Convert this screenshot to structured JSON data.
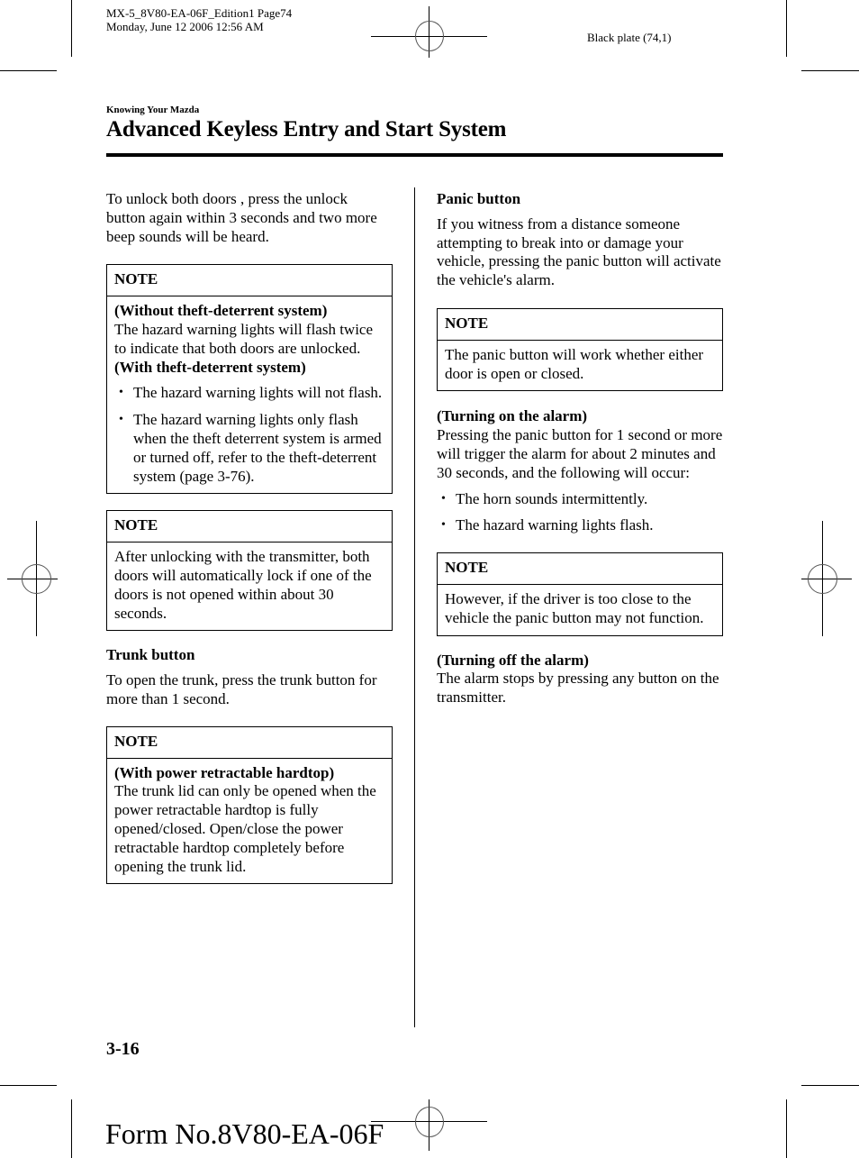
{
  "slug": {
    "line1": "MX-5_8V80-EA-06F_Edition1 Page74",
    "line2": "Monday, June 12 2006 12:56 AM",
    "plate": "Black plate (74,1)"
  },
  "header": {
    "section": "Knowing Your Mazda",
    "title": "Advanced Keyless Entry and Start System"
  },
  "left": {
    "intro": "To unlock both doors , press the unlock button again within 3 seconds and two more beep sounds will be heard.",
    "note1": {
      "label": "NOTE",
      "sub1": "(Without theft-deterrent system)",
      "text1": "The hazard warning lights will flash twice to indicate that both doors are unlocked.",
      "sub2": "(With theft-deterrent system)",
      "bullets": [
        "The hazard warning lights will not flash.",
        "The hazard warning lights only flash when the theft deterrent system is armed or turned off, refer to the theft-deterrent system (page 3-76)."
      ]
    },
    "note2": {
      "label": "NOTE",
      "text": "After unlocking with the transmitter, both doors will automatically lock if one of the doors is not opened within about 30 seconds."
    },
    "trunk_heading": "Trunk button",
    "trunk_text": "To open the trunk, press the trunk button for more than 1 second.",
    "note3": {
      "label": "NOTE",
      "sub": "(With power retractable hardtop)",
      "text": "The trunk lid can only be opened when the power retractable hardtop is fully opened/closed. Open/close the power retractable hardtop completely before opening the trunk lid."
    }
  },
  "right": {
    "panic_heading": "Panic button",
    "panic_text": "If you witness from a distance someone attempting to break into or damage your vehicle, pressing the panic button will activate the vehicle's alarm.",
    "note4": {
      "label": "NOTE",
      "text": "The panic button will work whether either door is open or closed."
    },
    "on_heading": "(Turning on the alarm)",
    "on_text": "Pressing the panic button for 1 second or more will trigger the alarm for about 2 minutes and 30 seconds, and the following will occur:",
    "on_bullets": [
      "The horn sounds intermittently.",
      "The hazard warning lights flash."
    ],
    "note5": {
      "label": "NOTE",
      "text": "However, if the driver is too close to the vehicle the panic button may not function."
    },
    "off_heading": "(Turning off the alarm)",
    "off_text": "The alarm stops by pressing any button on the transmitter."
  },
  "footer": {
    "page_number": "3-16",
    "form_number": "Form No.8V80-EA-06F"
  }
}
